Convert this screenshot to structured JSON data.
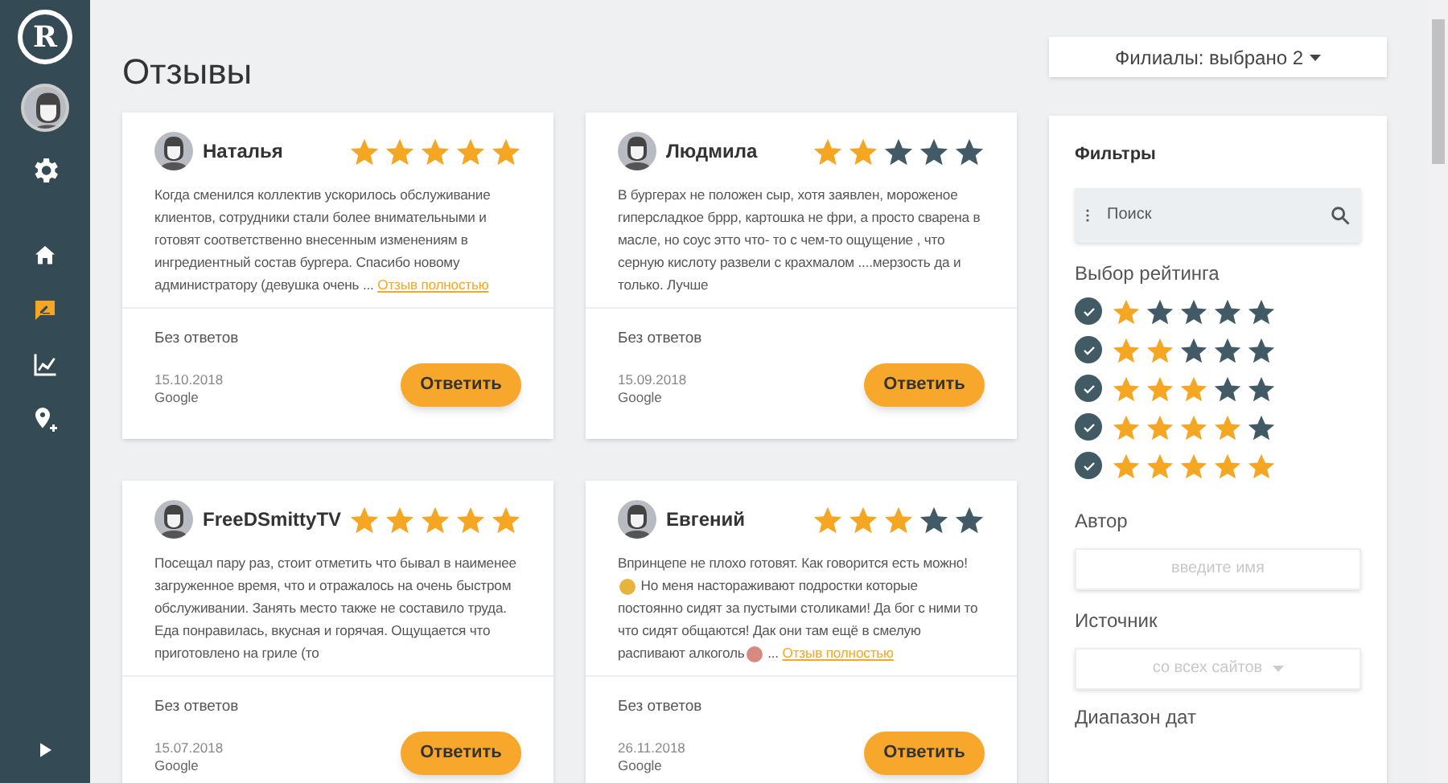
{
  "sidebar": {
    "logo": "R",
    "items": [
      {
        "kind": "home",
        "selected": false
      },
      {
        "kind": "reviews",
        "selected": true
      },
      {
        "kind": "chart",
        "selected": false
      },
      {
        "kind": "location",
        "selected": false
      }
    ]
  },
  "title": "Отзывы",
  "branches_dropdown": "Филиалы: выбрано 2",
  "reviews": [
    {
      "author": "Наталья",
      "stars": 5,
      "text": [
        {
          "kind": "text",
          "text": "Когда сменился коллектив ускорилось обслуживание клиентов, сотрудники стали более внимательными и готовят соответственно внесенным изменениям в ингредиентный состав бургера. Спасибо новому администратору (девушка очень"
        }
      ],
      "ellipsis": "...",
      "full_link": "Отзыв полностью",
      "replies": "Без ответов",
      "date": "15.10.2018",
      "source": "Google",
      "reply_button": "Ответить"
    },
    {
      "author": "Людмила",
      "stars": 2,
      "text": [
        {
          "kind": "text",
          "text": "В бургерах не положен сыр, хотя заявлен, мороженое гиперсладкое бррр, картошка не фри, а просто сварена в масле, но соус этто что- то с чем-то ощущение , что серную кислоту развели с крахмалом ....мерзость да и только. Лучше"
        }
      ],
      "replies": "Без ответов",
      "date": "15.09.2018",
      "source": "Google",
      "reply_button": "Ответить"
    },
    {
      "author": "FreeDSmittyTV",
      "stars": 5,
      "text": [
        {
          "kind": "text",
          "text": "Посещал пару раз, стоит отметить что бывал в наименее загруженное время, что и отражалось на очень быстром обслуживании. Занять место также не составило труда. Еда понравилась, вкусная и горячая. Ощущается что приготовлено на гриле (то"
        }
      ],
      "replies": "Без ответов",
      "date": "15.07.2018",
      "source": "Google",
      "reply_button": "Ответить"
    },
    {
      "author": "Евгений",
      "stars": 3,
      "text": [
        {
          "kind": "text",
          "text": "Впринцепе не плохо готовят. Как говорится есть можно!"
        },
        {
          "kind": "emoji",
          "color": "#e8b33a"
        },
        {
          "kind": "text",
          "text": " Но меня настораживают подростки которые постоянно сидят за пустыми столиками! Да бог с ними то что сидят общаются! Дак они там ещё в смелую распивают алкоголь"
        },
        {
          "kind": "emoji",
          "color": "#d98a7e"
        }
      ],
      "ellipsis": "...",
      "full_link": "Отзыв полностью",
      "replies": "Без ответов",
      "date": "26.11.2018",
      "source": "Google",
      "reply_button": "Ответить"
    }
  ],
  "filters": {
    "title": "Фильтры",
    "search": {
      "placeholder": "Поиск"
    },
    "rating_title": "Выбор рейтинга",
    "ratings": [
      {
        "checked": true,
        "stars": 1
      },
      {
        "checked": true,
        "stars": 2
      },
      {
        "checked": true,
        "stars": 3
      },
      {
        "checked": true,
        "stars": 4
      },
      {
        "checked": true,
        "stars": 5
      }
    ],
    "author_title": "Автор",
    "author_field": {
      "placeholder": "введите имя"
    },
    "source_title": "Источник",
    "source_select": "со всех сайтов",
    "date_range_title": "Диапазон дат"
  }
}
